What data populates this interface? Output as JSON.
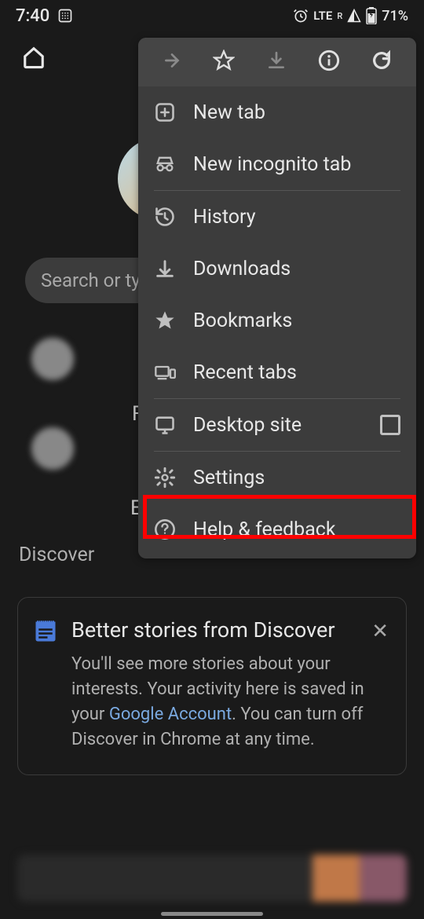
{
  "status": {
    "time": "7:40",
    "alarm": true,
    "network": "LTE",
    "roaming": "R",
    "battery": "71%"
  },
  "search": {
    "placeholder": "Search or ty"
  },
  "discover_label": "Discover",
  "bg_letters": {
    "f": "F",
    "e": "E"
  },
  "menu": {
    "items": {
      "new_tab": "New tab",
      "incognito": "New incognito tab",
      "history": "History",
      "downloads": "Downloads",
      "bookmarks": "Bookmarks",
      "recent": "Recent tabs",
      "desktop": "Desktop site",
      "settings": "Settings",
      "help": "Help & feedback"
    }
  },
  "card": {
    "title": "Better stories from Discover",
    "body_pre": "You'll see more stories about your interests. Your activity here is saved in your ",
    "link": "Google Account",
    "body_post": ". You can turn off Discover in Chrome at any time."
  }
}
